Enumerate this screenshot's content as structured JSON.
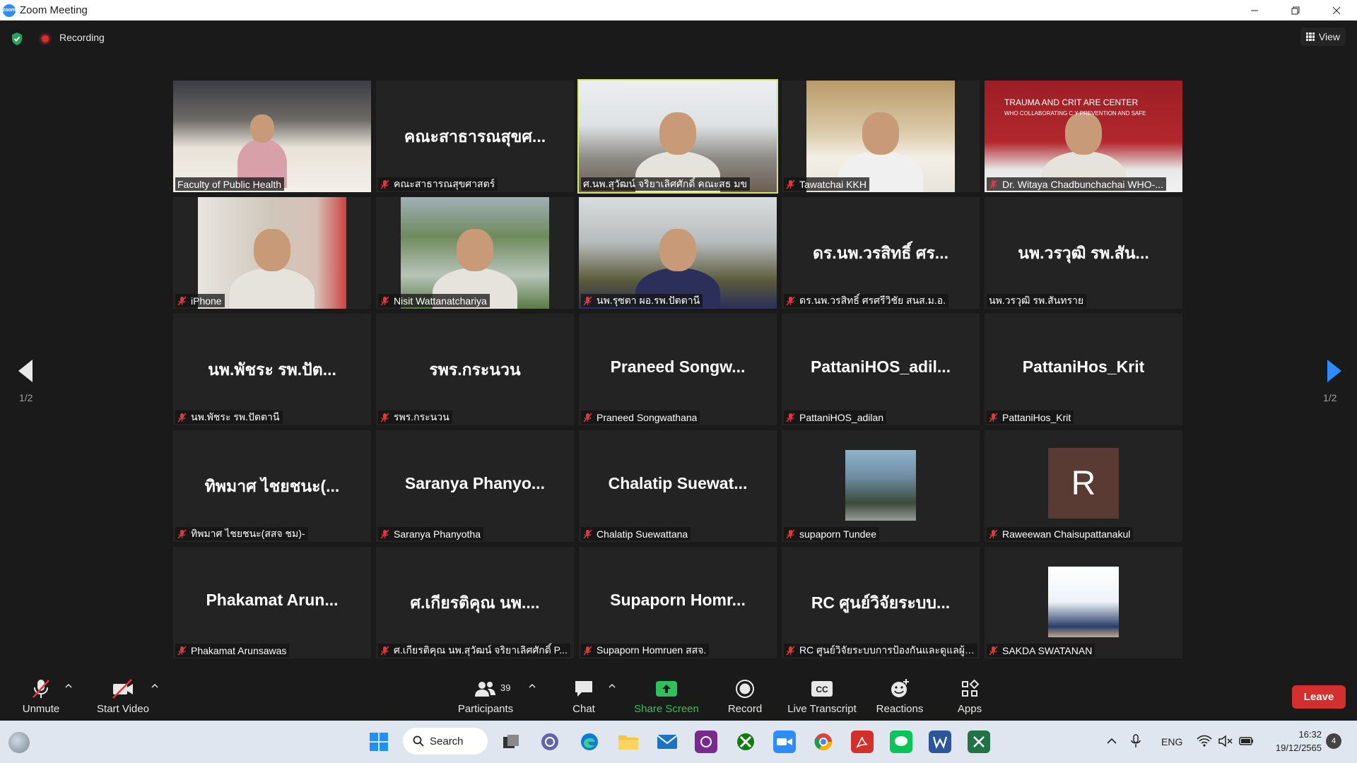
{
  "window": {
    "title": "Zoom Meeting",
    "app_icon_text": "zoom"
  },
  "topbar": {
    "recording_label": "Recording",
    "view_label": "View"
  },
  "paging": {
    "left_label": "1/2",
    "right_label": "1/2"
  },
  "tiles": [
    {
      "caption": "Faculty of Public Health",
      "bigname": "",
      "video": true,
      "muted": false
    },
    {
      "caption": "คณะสาธารณสุขศาสตร์",
      "bigname": "คณะสาธารณสุขศ...",
      "video": false,
      "muted": true
    },
    {
      "caption": "ศ.นพ.สุวัฒน์ จริยาเลิศศักดิ์ คณะสธ มข",
      "bigname": "",
      "video": true,
      "muted": false,
      "active": true
    },
    {
      "caption": "Tawatchai KKH",
      "bigname": "",
      "video": true,
      "muted": true
    },
    {
      "caption": "Dr. Witaya Chadbunchachai WHO-...",
      "bigname": "",
      "video": true,
      "muted": true,
      "banner_title": "TRAUMA AND CRIT ARE CENTER",
      "banner_sub": "WHO COLLABORATING C Y PREVENTION AND SAFE"
    },
    {
      "caption": "iPhone",
      "bigname": "",
      "video": true,
      "muted": true
    },
    {
      "caption": "Nisit Wattanatchariya",
      "bigname": "",
      "video": true,
      "muted": true
    },
    {
      "caption": "นพ.รุซตา ผอ.รพ.ปัตตานี",
      "bigname": "",
      "video": true,
      "muted": true
    },
    {
      "caption": "ดร.นพ.วรสิทธิ์ ศรศรีวิชัย สนส.ม.อ.",
      "bigname": "ดร.นพ.วรสิทธิ์ ศร...",
      "video": false,
      "muted": true
    },
    {
      "caption": "นพ.วรวุฒิ รพ.สันทราย",
      "bigname": "นพ.วรวุฒิ รพ.สัน...",
      "video": false,
      "muted": false
    },
    {
      "caption": "นพ.พัชระ รพ.ปัตตานี",
      "bigname": "นพ.พัชระ รพ.ปัต...",
      "video": false,
      "muted": true
    },
    {
      "caption": "รพร.กระนวน",
      "bigname": "รพร.กระนวน",
      "video": false,
      "muted": true
    },
    {
      "caption": "Praneed Songwathana",
      "bigname": "Praneed Songw...",
      "video": false,
      "muted": true
    },
    {
      "caption": "PattaniHOS_adilan",
      "bigname": "PattaniHOS_adil...",
      "video": false,
      "muted": true
    },
    {
      "caption": "PattaniHos_Krit",
      "bigname": "PattaniHos_Krit",
      "video": false,
      "muted": true
    },
    {
      "caption": "ทิพมาศ ไชยชนะ(สสจ ชม)-",
      "bigname": "ทิพมาศ ไชยชนะ(...",
      "video": false,
      "muted": true
    },
    {
      "caption": "Saranya Phanyotha",
      "bigname": "Saranya Phanyo...",
      "video": false,
      "muted": true
    },
    {
      "caption": "Chalatip Suewattana",
      "bigname": "Chalatip Suewat...",
      "video": false,
      "muted": true
    },
    {
      "caption": "supaporn Tundee",
      "bigname": "",
      "video": true,
      "muted": true,
      "small_photo": true
    },
    {
      "caption": "Raweewan Chaisupattanakul",
      "bigname": "",
      "video": false,
      "muted": true,
      "avatar_letter": "R"
    },
    {
      "caption": "Phakamat Arunsawas",
      "bigname": "Phakamat Arun...",
      "video": false,
      "muted": true
    },
    {
      "caption": "ศ.เกียรติคุณ นพ.สุวัฒน์ จริยาเลิศศักดิ์ P...",
      "bigname": "ศ.เกียรติคุณ นพ....",
      "video": false,
      "muted": true
    },
    {
      "caption": "Supaporn Homruen สสจ.",
      "bigname": "Supaporn Homr...",
      "video": false,
      "muted": true
    },
    {
      "caption": "RC ศูนย์วิจัยระบบการป้องกันและดูแลผู้บ...",
      "bigname": "RC ศูนย์วิจัยระบบ...",
      "video": false,
      "muted": true
    },
    {
      "caption": "SAKDA SWATANAN",
      "bigname": "",
      "video": true,
      "muted": true,
      "small_photo": true
    }
  ],
  "toolbar": {
    "unmute": "Unmute",
    "start_video": "Start Video",
    "participants": "Participants",
    "participants_count": "39",
    "chat": "Chat",
    "share_screen": "Share Screen",
    "record": "Record",
    "live_transcript": "Live Transcript",
    "live_transcript_icon": "CC",
    "reactions": "Reactions",
    "apps": "Apps",
    "leave": "Leave"
  },
  "taskbar": {
    "search": "Search",
    "lang": "ENG",
    "time": "16:32",
    "date": "19/12/2565",
    "notif_count": "4"
  },
  "colors": {
    "active_border": "#d6e85a",
    "leave": "#d32f2f",
    "share_green": "#2ec05a",
    "mute_red": "#e0383e"
  }
}
